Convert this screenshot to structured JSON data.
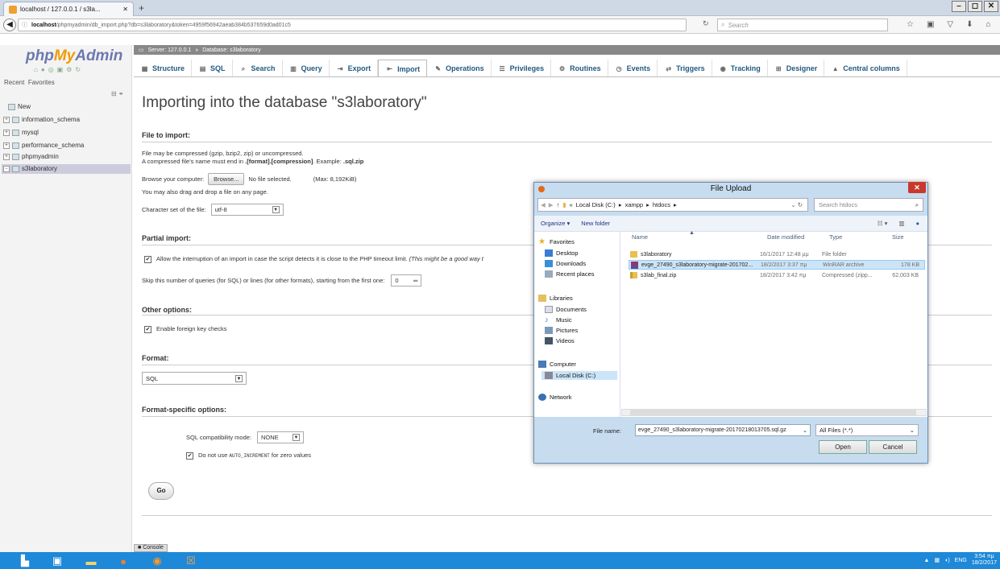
{
  "browser": {
    "tab_title": "localhost / 127.0.0.1 / s3la...",
    "tab_close": "✕",
    "new_tab": "+",
    "url_host": "localhost",
    "url_path": "/phpmyadmin/db_import.php?db=s3laboratory&token=4959f56942aeab384b537659d0ad01c5",
    "search_placeholder": "Search",
    "window_buttons": [
      "–",
      "◻",
      "✕"
    ]
  },
  "sidebar": {
    "logo_php": "php",
    "logo_my": "My",
    "logo_admin": "Admin",
    "recent_label": "Recent",
    "favorites_label": "Favorites",
    "tree": [
      "New",
      "information_schema",
      "mysql",
      "performance_schema",
      "phpmyadmin",
      "s3laboratory"
    ]
  },
  "breadcrumb": {
    "server": "Server: 127.0.0.1",
    "sep": "»",
    "database": "Database: s3laboratory"
  },
  "tabs": [
    {
      "label": "Structure",
      "icon": "▦"
    },
    {
      "label": "SQL",
      "icon": "▤"
    },
    {
      "label": "Search",
      "icon": "⌕"
    },
    {
      "label": "Query",
      "icon": "▥"
    },
    {
      "label": "Export",
      "icon": "⇥"
    },
    {
      "label": "Import",
      "icon": "⇤"
    },
    {
      "label": "Operations",
      "icon": "✎"
    },
    {
      "label": "Privileges",
      "icon": "☰"
    },
    {
      "label": "Routines",
      "icon": "⚙"
    },
    {
      "label": "Events",
      "icon": "◷"
    },
    {
      "label": "Triggers",
      "icon": "⇄"
    },
    {
      "label": "Tracking",
      "icon": "◉"
    },
    {
      "label": "Designer",
      "icon": "⊞"
    },
    {
      "label": "Central columns",
      "icon": "▲"
    }
  ],
  "import": {
    "heading": "Importing into the database \"s3laboratory\"",
    "file_section": "File to import:",
    "compress_note1": "File may be compressed (gzip, bzip2, zip) or uncompressed.",
    "compress_note2_a": "A compressed file's name must end in ",
    "compress_note2_b": ".[format].[compression]",
    "compress_note2_c": ". Example: ",
    "compress_note2_d": ".sql.zip",
    "browse_label": "Browse your computer:",
    "browse_button": "Browse...",
    "no_file": "No file selected.",
    "max_size": "(Max: 8,192KiB)",
    "drag_note": "You may also drag and drop a file on any page.",
    "charset_label": "Character set of the file:",
    "charset_value": "utf-8",
    "partial_section": "Partial import:",
    "allow_interrupt": "Allow the interruption of an import in case the script detects it is close to the PHP timeout limit.",
    "allow_interrupt_italic": "(This might be a good way t",
    "skip_label": "Skip this number of queries (for SQL) or lines (for other formats), starting from the first one:",
    "skip_value": "0",
    "other_section": "Other options:",
    "foreign_keys": "Enable foreign key checks",
    "format_section": "Format:",
    "format_value": "SQL",
    "fso_section": "Format-specific options:",
    "compat_label": "SQL compatibility mode:",
    "compat_value": "NONE",
    "auto_inc_a": "Do not use ",
    "auto_inc_code": "AUTO_INCREMENT",
    "auto_inc_b": " for zero values",
    "go_button": "Go",
    "console_label": "Console"
  },
  "dialog": {
    "title": "File Upload",
    "close": "✕",
    "path": [
      "«",
      "Local Disk (C:)",
      "xampp",
      "htdocs"
    ],
    "search_placeholder": "Search htdocs",
    "organize": "Organize ▾",
    "new_folder": "New folder",
    "nav": {
      "favorites": "Favorites",
      "desktop": "Desktop",
      "downloads": "Downloads",
      "recent": "Recent places",
      "libraries": "Libraries",
      "documents": "Documents",
      "music": "Music",
      "pictures": "Pictures",
      "videos": "Videos",
      "computer": "Computer",
      "localdisk": "Local Disk (C:)",
      "network": "Network"
    },
    "columns": {
      "name": "Name",
      "date": "Date modified",
      "type": "Type",
      "size": "Size"
    },
    "files": [
      {
        "name": "s3laboratory",
        "date": "16/1/2017 12:48 μμ",
        "type": "File folder",
        "size": ""
      },
      {
        "name": "evge_27490_s3laboratory-migrate-201702...",
        "date": "18/2/2017 3:37 πμ",
        "type": "WinRAR archive",
        "size": "178 KB"
      },
      {
        "name": "s3lab_final.zip",
        "date": "18/2/2017 3:42 πμ",
        "type": "Compressed (zipp...",
        "size": "62,003 KB"
      }
    ],
    "filename_label": "File name:",
    "filename_value": "evge_27490_s3laboratory-migrate-20170218013705.sql.gz",
    "filetype_value": "All Files (*.*)",
    "open_button": "Open",
    "cancel_button": "Cancel"
  },
  "taskbar": {
    "lang": "ENG",
    "time": "3:54 πμ",
    "date": "18/2/2017"
  }
}
